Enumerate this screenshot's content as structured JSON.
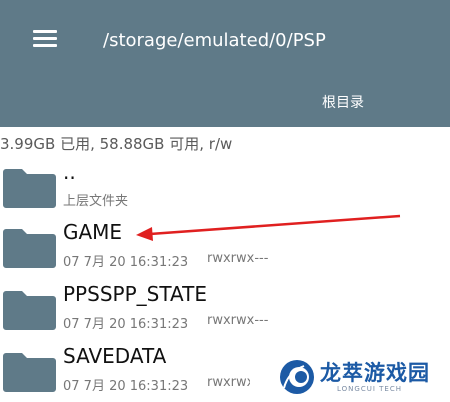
{
  "header": {
    "path": "/storage/emulated/0/PSP",
    "root_button": "根目录"
  },
  "storage_info": "3.99GB 已用, 58.88GB 可用, r/w",
  "files": [
    {
      "name": "..",
      "sub": "上层文件夹"
    },
    {
      "name": "GAME",
      "date": "07 7月 20 16:31:23",
      "perm": "rwxrwx---"
    },
    {
      "name": "PPSSPP_STATE",
      "date": "07 7月 20 16:31:23",
      "perm": "rwxrwx---"
    },
    {
      "name": "SAVEDATA",
      "date": "07 7月 20 16:31:23",
      "perm": "rwxrwx---"
    }
  ],
  "watermark": {
    "title": "龙萃游戏园",
    "subtitle": "LONGCUI TECH"
  },
  "colors": {
    "appbar": "#5f7a88",
    "folder": "#5f7a88",
    "arrow": "#e02020"
  }
}
